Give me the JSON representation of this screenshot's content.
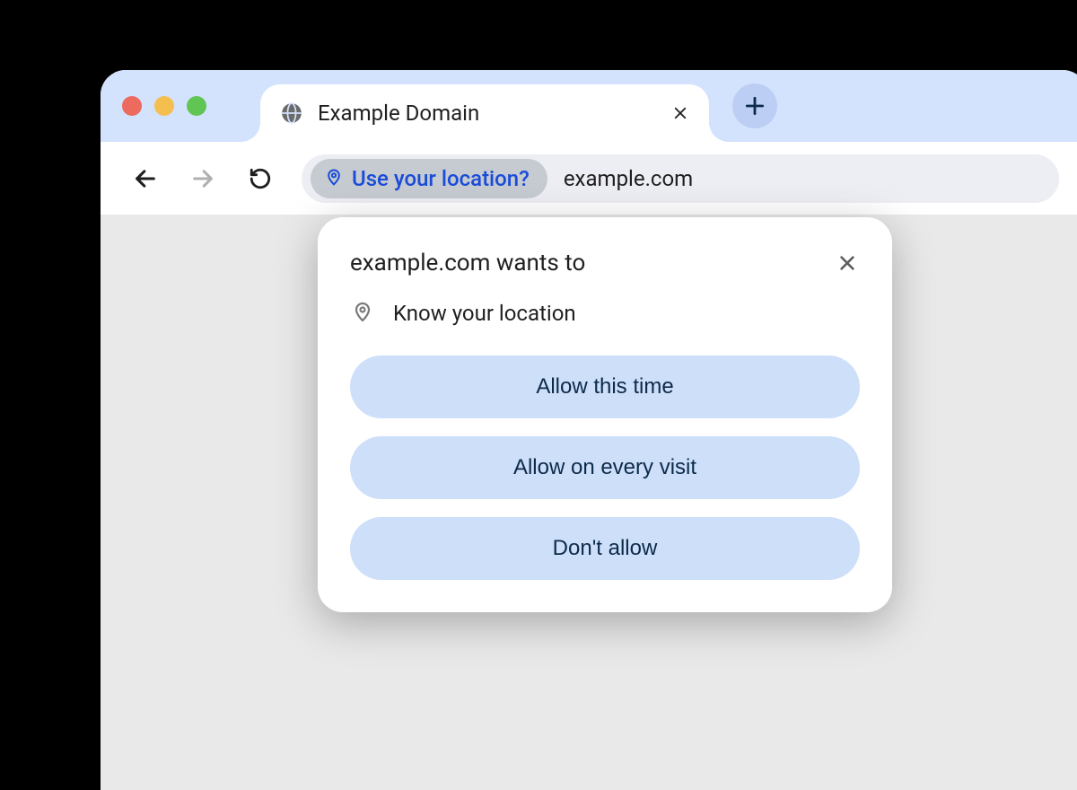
{
  "tab": {
    "title": "Example Domain"
  },
  "address_bar": {
    "permission_chip": "Use your location?",
    "url": "example.com"
  },
  "popup": {
    "title": "example.com wants to",
    "request_text": "Know your location",
    "buttons": {
      "allow_once": "Allow this time",
      "allow_always": "Allow on every visit",
      "deny": "Don't allow"
    }
  }
}
